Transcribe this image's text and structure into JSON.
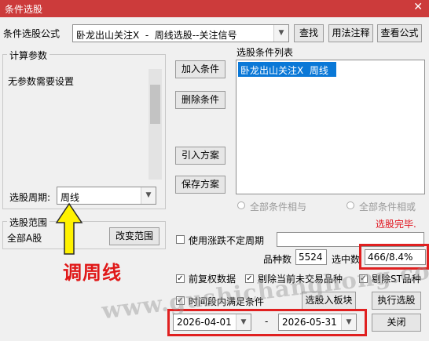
{
  "window": {
    "title": "条件选股",
    "close_glyph": "✕"
  },
  "formula": {
    "label": "条件选股公式",
    "value": "卧龙出山关注X  -  周线选股--关注信号",
    "buttons": [
      "查找",
      "用法注释",
      "查看公式"
    ]
  },
  "params": {
    "legend": "计算参数",
    "empty_text": "无参数需要设置"
  },
  "period": {
    "label": "选股周期:",
    "value": "周线"
  },
  "conditions": {
    "buttons": [
      "加入条件",
      "删除条件",
      "引入方案",
      "保存方案"
    ],
    "list_legend": "选股条件列表",
    "items": [
      "卧龙出山关注X  周线"
    ],
    "radio_and": "全部条件相与",
    "radio_or": "全部条件相或"
  },
  "status": {
    "text": "选股完毕."
  },
  "scope": {
    "legend": "选股范围",
    "value": "全部A股",
    "change_button": "改变范围"
  },
  "annotation": {
    "text": "调周线"
  },
  "unfixed_period": {
    "label": "使用涨跌不定周期"
  },
  "stats": {
    "count_label": "品种数",
    "count_value": "5524",
    "selected_label": "选中数",
    "selected_value": "466/8.4%"
  },
  "options": {
    "adjusted": "前复权数据",
    "exclude_no_trade": "剔除当前未交易品种",
    "exclude_st": "剔除ST品种",
    "time_range": "时间段内满足条件"
  },
  "actions": {
    "to_board": "选股入板块",
    "run": "执行选股",
    "close": "关闭"
  },
  "dates": {
    "start": "2026-04-01",
    "separator": "-",
    "end": "2026-05-31"
  },
  "watermark": "www.gushichanghong.com"
}
